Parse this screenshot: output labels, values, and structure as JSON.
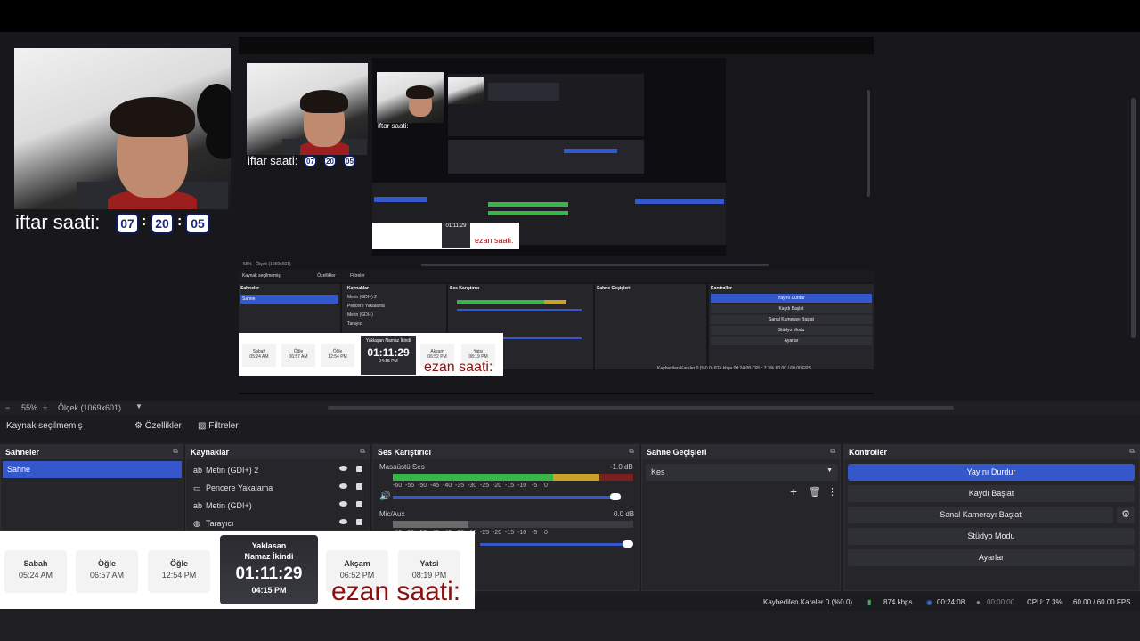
{
  "webcam_overlay": {
    "label": "iftar saati:",
    "hours": "07",
    "minutes": "20",
    "seconds": "05"
  },
  "nested_overlay": {
    "label": "iftar saati:",
    "hours": "07",
    "minutes": "20",
    "seconds": "05",
    "small_label": "iftar saati:",
    "countdown": "01:11:29",
    "ezan": "ezan saati:"
  },
  "nested_program": {
    "source_label": "Kaynak seçilmemiş",
    "properties": "Özellikler",
    "filters": "Filtreler",
    "scenes_title": "Sahneler",
    "scene": "Sahne",
    "sources_title": "Kaynaklar",
    "sources": [
      "Metin (GDI+) 2",
      "Pencere Yakalama",
      "Metin (GDI+)",
      "Tarayıcı"
    ],
    "mixer_title": "Ses Karıştırıcı",
    "transitions_title": "Sahne Geçişleri",
    "controls_title": "Kontroller",
    "controls": [
      "Yayını Durdur",
      "Kaydı Başlat",
      "Sanal Kamerayı Başlat",
      "Stüdyo Modu",
      "Ayarlar"
    ],
    "status": "Kaybedilen Kareler 0 (%0.0)   874 kbps   00:24:08   CPU: 7.3%   60.00 / 60.00 FPS",
    "zoom": "55%",
    "scale": "Ölçek (1069x601)",
    "prayers": [
      {
        "name": "Sabah",
        "time": "05:24 AM"
      },
      {
        "name": "Öğle",
        "time": "06:57 AM"
      },
      {
        "name": "Öğle",
        "time": "12:54 PM"
      },
      {
        "name": "Akşam",
        "time": "06:52 PM"
      },
      {
        "name": "Yatsı",
        "time": "08:19 PM"
      }
    ],
    "countdown_title": "Yaklaşan Namaz İkindi",
    "countdown": "01:11:29",
    "countdown_time": "04:15 PM",
    "ezan": "ezan saati:"
  },
  "toolbar": {
    "zoom": "55%",
    "scale": "Ölçek (1069x601)",
    "source_label": "Kaynak seçilmemiş",
    "properties": "Özellikler",
    "filters": "Filtreler"
  },
  "scenes": {
    "title": "Sahneler",
    "items": [
      "Sahne"
    ]
  },
  "sources": {
    "title": "Kaynaklar",
    "items": [
      {
        "label": "Metin (GDI+) 2",
        "icon": "text-icon"
      },
      {
        "label": "Pencere Yakalama",
        "icon": "window-icon"
      },
      {
        "label": "Metin (GDI+)",
        "icon": "text-icon"
      },
      {
        "label": "Tarayıcı",
        "icon": "globe-icon"
      }
    ]
  },
  "mixer": {
    "title": "Ses Karıştırıcı",
    "channels": [
      {
        "name": "Masaüstü Ses",
        "db": "-1.0 dB"
      },
      {
        "name": "Mic/Aux",
        "db": "0.0 dB"
      }
    ],
    "ticks": [
      "-60",
      "-55",
      "-50",
      "-45",
      "-40",
      "-35",
      "-30",
      "-25",
      "-20",
      "-15",
      "-10",
      "-5",
      "0"
    ]
  },
  "transitions": {
    "title": "Sahne Geçişleri",
    "selected": "Kes"
  },
  "controls": {
    "title": "Kontroller",
    "buttons": [
      "Yayını Durdur",
      "Kaydı Başlat",
      "Sanal Kamerayı Başlat",
      "Stüdyo Modu",
      "Ayarlar"
    ]
  },
  "prayer_widget": {
    "prayers": [
      {
        "name": "Sabah",
        "time": "05:24 AM"
      },
      {
        "name": "Öğle",
        "time": "06:57 AM"
      },
      {
        "name": "Öğle",
        "time": "12:54 PM"
      },
      {
        "name": "Akşam",
        "time": "06:52 PM"
      },
      {
        "name": "Yatsi",
        "time": "08:19 PM"
      }
    ],
    "countdown_title": "Yaklasan Namaz İkindi",
    "countdown": "01:11:29",
    "countdown_time": "04:15 PM",
    "ezan": "ezan saati:"
  },
  "status": {
    "dropped": "Kaybedilen Kareler 0 (%0.0)",
    "bitrate": "874 kbps",
    "stream_time": "00:24:08",
    "record_time": "00:00:00",
    "cpu": "CPU: 7.3%",
    "fps": "60.00 / 60.00 FPS"
  },
  "colors": {
    "accent": "#3457c9",
    "ezan": "#8a1010",
    "meter_green": "#39b54a",
    "meter_yellow": "#c9a227",
    "meter_red": "#b33131"
  }
}
